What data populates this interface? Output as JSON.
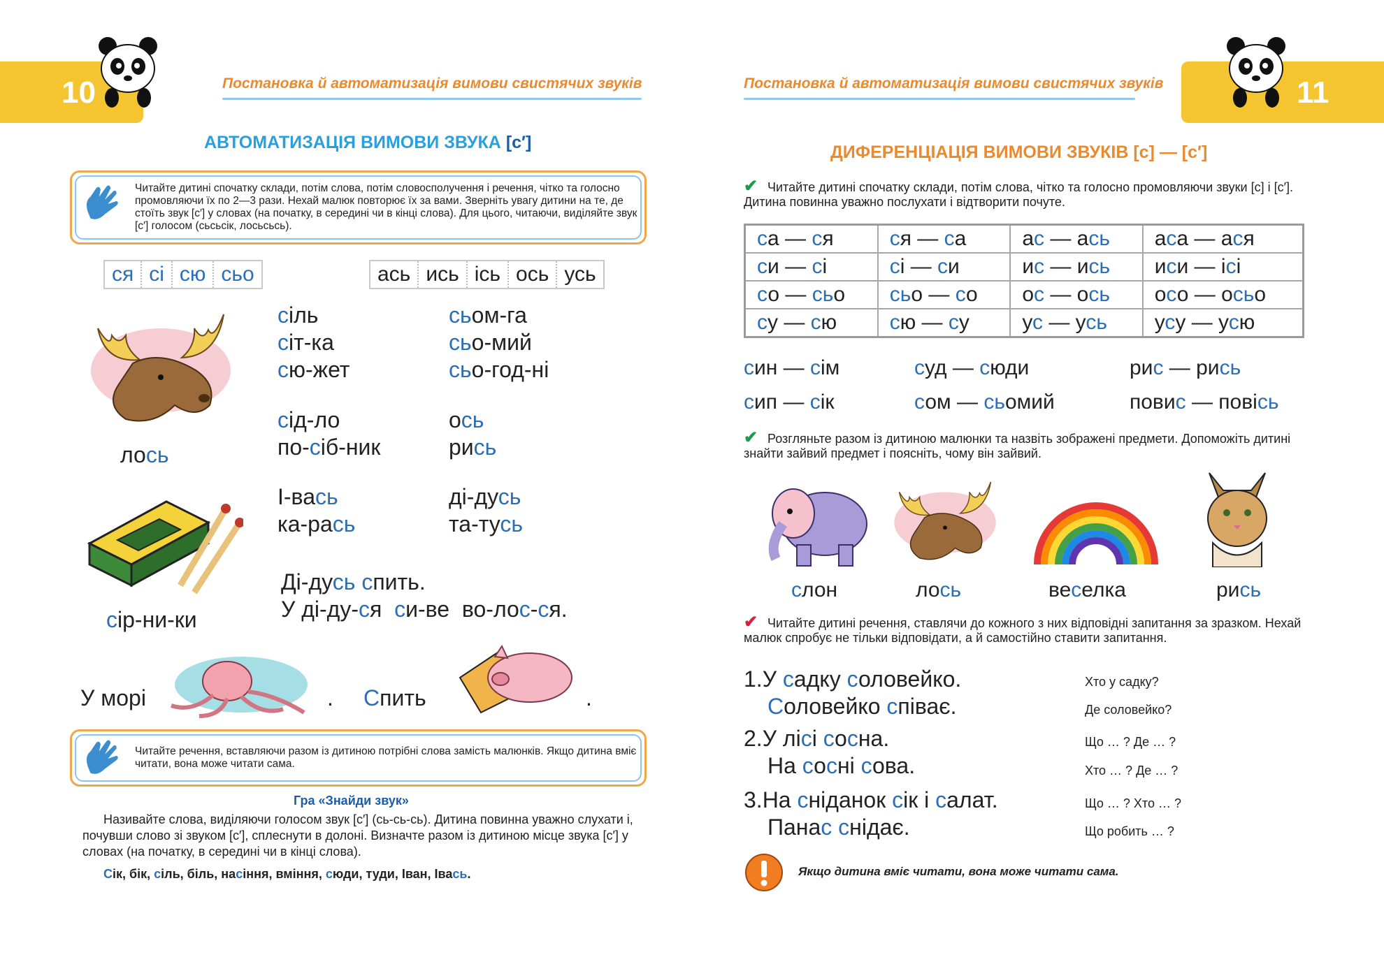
{
  "left": {
    "page_number": "10",
    "header": "Постановка й автоматизація вимови свистячих звуків",
    "title_prefix": "АВТОМАТИЗАЦІЯ ВИМОВИ ЗВУКА ",
    "title_sound": "[с′]",
    "note1": "Читайте дитині спочатку склади, потім слова, потім словосполучення і речення, чітко та голосно промовляючи їх по 2—3 рази. Нехай малюк повторює їх за вами. Зверніть увагу дитини на те, де стоїть звук [с′] у словах (на початку, в середині чи в кінці слова). Для цього, читаючи, виділяйте звук [с′] голосом (сьсьсік, лосьсьсь).",
    "syl1": [
      "ся",
      "сі",
      "сю",
      "сьо"
    ],
    "syl2": [
      "ась",
      "ись",
      "ісь",
      "ось",
      "усь"
    ],
    "w_col1a": [
      "сіль",
      "сіт-ка",
      "сю-жет"
    ],
    "w_col2a": [
      "сьом-га",
      "сьо-мий",
      "сьо-год-ні"
    ],
    "moose_label": "лось",
    "w_col1b": [
      "сід-ло",
      "по-сіб-ник"
    ],
    "w_col2b": [
      "ось",
      "рись"
    ],
    "w_col1c": [
      "І-вась",
      "ка-рась"
    ],
    "w_col2c": [
      "ді-дусь",
      "та-тусь"
    ],
    "sent1": "Ді-дусь спить.",
    "sent2": "У ді-ду-ся си-ве во-лос-ся.",
    "matches_label": "сір-ни-ки",
    "pic_sent1": "У морі",
    "pic_sent2": "Спить",
    "dot": ".",
    "note2": "Читайте речення, вставляючи разом із дитиною потрібні слова замість малюнків. Якщо дитина вміє читати, вона може читати сама.",
    "game_title": "Гра «Знайди звук»",
    "game_text": "Називайте слова, виділяючи голосом звук [с′] (сь-сь-сь). Дитина повинна уважно слухати і, почувши слово зі звуком [с′], сплеснути в долоні. Визначте разом із дитиною місце звука [с′] у словах (на початку, в середині чи в кінці слова).",
    "game_words": "Сік, бік, сіль, біль, насіння, вміння, сюди, туди, Іван, Івась."
  },
  "right": {
    "page_number": "11",
    "header": "Постановка й автоматизація вимови свистячих звуків",
    "title": "ДИФЕРЕНЦІАЦІЯ ВИМОВИ ЗВУКІВ [с] — [с′]",
    "instr1": "Читайте дитині спочатку склади, потім слова, чітко та голосно промовляючи звуки [с] і [с′]. Дитина повинна уважно послухати і відтворити почуте.",
    "table": [
      [
        "са — ся",
        "ся — са",
        "ас — ась",
        "аса — ася"
      ],
      [
        "си — сі",
        "сі — си",
        "ис — ись",
        "иси — ісі"
      ],
      [
        "со — сьо",
        "сьо — со",
        "ос — ось",
        "осо — осьо"
      ],
      [
        "су — сю",
        "сю — су",
        "ус — усь",
        "усу — усю"
      ]
    ],
    "pairs": [
      [
        "син — сім",
        "суд — сюди",
        "рис — рись"
      ],
      [
        "сип — сік",
        "сом — сьомий",
        "повис — повісь"
      ]
    ],
    "instr2": "Розгляньте разом із дитиною малюнки та назвіть зображені предмети. Допоможіть дитині знайти зайвий предмет і поясніть, чому він зайвий.",
    "pictures": [
      "слон",
      "лось",
      "веселка",
      "рись"
    ],
    "instr3": "Читайте дитині речення, ставлячи до кожного з них відповідні запитання за зразком. Нехай малюк спробує не тільки відповідати, а й самостійно ставити запитання.",
    "sentences": [
      {
        "num": "1.",
        "lines": [
          "У садку соловейко.",
          "Соловейко співає."
        ],
        "qs": [
          "Хто у садку?",
          "Де соловейко?"
        ]
      },
      {
        "num": "2.",
        "lines": [
          "У лісі сосна.",
          "На сосні сова."
        ],
        "qs": [
          "Що … ? Де … ?",
          "Хто … ? Де … ?"
        ]
      },
      {
        "num": "3.",
        "lines": [
          "На сніданок сік і салат.",
          "Панас снідає."
        ],
        "qs": [
          "Що … ? Хто … ?",
          "Що робить … ?"
        ]
      }
    ],
    "footer_note": "Якщо дитина вміє читати, вона може читати сама."
  },
  "colors": {
    "blue": "#2c6fb4",
    "orange": "#e98a2f",
    "title_blue": "#2a9fdd",
    "yellow": "#f5c531",
    "green": "#1a9a4a",
    "red": "#d8203d"
  }
}
